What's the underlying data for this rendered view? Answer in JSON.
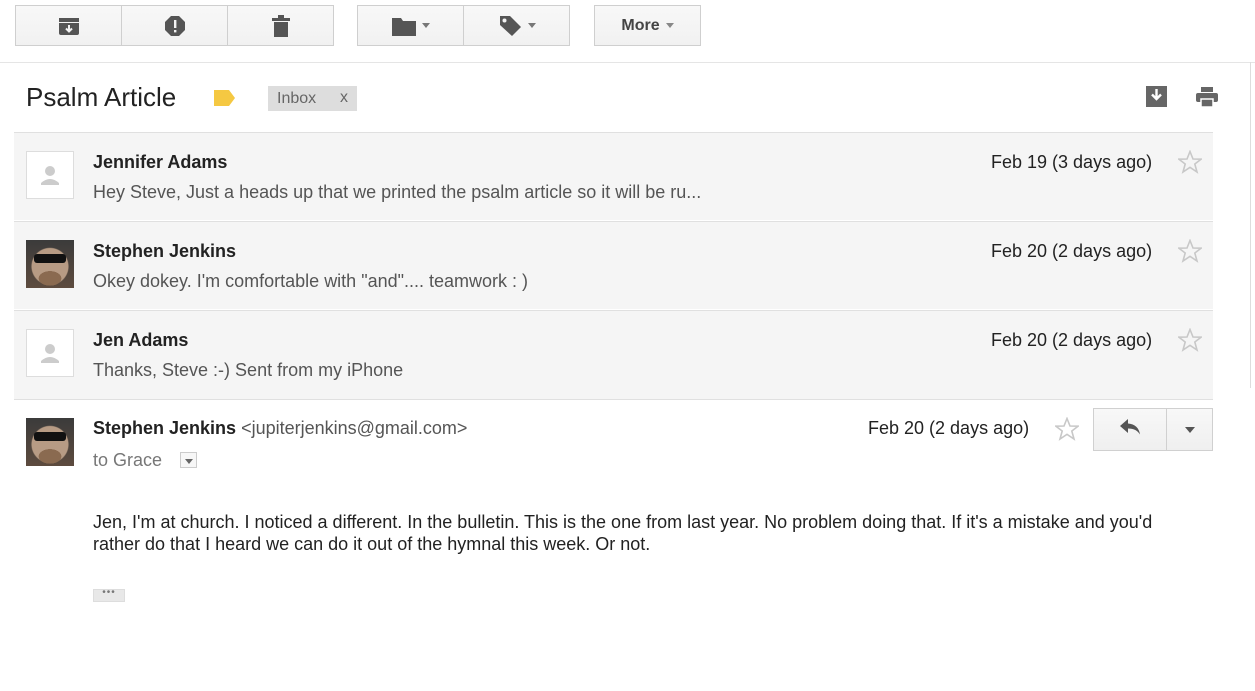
{
  "toolbar": {
    "archive_icon": "archive-icon",
    "spam_icon": "report-spam-icon",
    "delete_icon": "delete-icon",
    "move_icon": "folder-icon",
    "labels_icon": "label-icon",
    "more_label": "More"
  },
  "thread": {
    "subject": "Psalm Article",
    "label_color": "#f5c842",
    "inbox_chip": "Inbox",
    "inbox_chip_remove": "x",
    "download_icon": "download-icon",
    "print_icon": "print-icon"
  },
  "messages": [
    {
      "sender": "Jennifer Adams",
      "snippet": "Hey Steve, Just a heads up that we printed the psalm article so it will be ru...",
      "date": "Feb 19 (3 days ago)",
      "avatar": "placeholder"
    },
    {
      "sender": "Stephen Jenkins",
      "snippet": "Okey dokey. I'm comfortable with \"and\".... teamwork : )",
      "date": "Feb 20 (2 days ago)",
      "avatar": "photo"
    },
    {
      "sender": "Jen Adams",
      "snippet": "Thanks, Steve :-) Sent from my iPhone",
      "date": "Feb 20 (2 days ago)",
      "avatar": "placeholder"
    }
  ],
  "expanded": {
    "sender": "Stephen Jenkins",
    "email": "<jupiterjenkins@gmail.com>",
    "date": "Feb 20 (2 days ago)",
    "to": "to Grace",
    "body": "Jen, I'm at church. I noticed a different. In the bulletin. This is the one from last year. No problem doing that. If it's a mistake and you'd rather do that I heard we can do it out of the hymnal this week. Or not.",
    "trimmed": "•••"
  }
}
